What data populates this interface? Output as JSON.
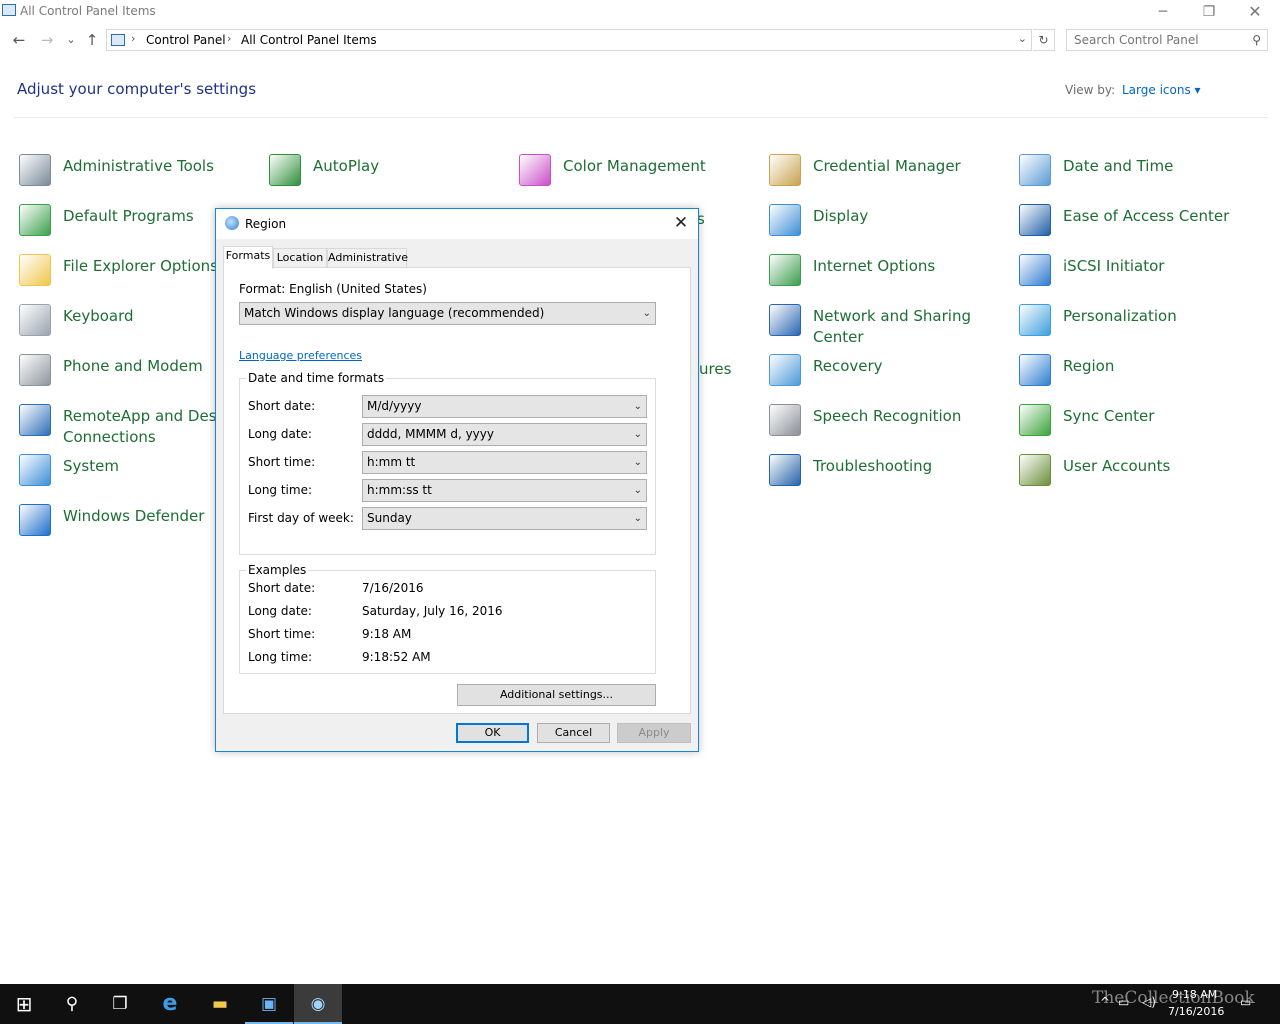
{
  "window": {
    "title": "All Control Panel Items",
    "controls": {
      "minimize": "─",
      "restore": "❐",
      "close": "✕"
    }
  },
  "nav": {
    "back": "←",
    "forward": "→",
    "recent": "⌄",
    "up": "↑"
  },
  "address": {
    "crumbs": [
      "Control Panel",
      "All Control Panel Items"
    ],
    "separator": "›",
    "dropdown": "⌄",
    "refresh": "↻"
  },
  "search": {
    "placeholder": "Search Control Panel",
    "icon": "⚲"
  },
  "header": {
    "heading": "Adjust your computer's settings",
    "view_by_label": "View by:",
    "view_by_value": "Large icons ▾"
  },
  "items": [
    {
      "label": "Administrative Tools",
      "icon": "admin-tools-icon",
      "color": "#7a8a99"
    },
    {
      "label": "AutoPlay",
      "icon": "autoplay-icon",
      "color": "#2f8f3a"
    },
    {
      "label": "Color Management",
      "icon": "color-management-icon",
      "color": "#c94fc9"
    },
    {
      "label": "Credential Manager",
      "icon": "credential-manager-icon",
      "color": "#c9a34f"
    },
    {
      "label": "Date and Time",
      "icon": "date-time-icon",
      "color": "#5b9bd5"
    },
    {
      "label": "Default Programs",
      "icon": "default-programs-icon",
      "color": "#3aa04a"
    },
    {
      "label": "Display",
      "icon": "display-icon",
      "color": "#3c8fd6"
    },
    {
      "label": "Ease of Access Center",
      "icon": "ease-of-access-icon",
      "color": "#1f5fa8"
    },
    {
      "label": "File Explorer Options",
      "icon": "file-explorer-icon",
      "color": "#f0c64a"
    },
    {
      "label": "Internet Options",
      "icon": "internet-options-icon",
      "color": "#3b9d4d"
    },
    {
      "label": "iSCSI Initiator",
      "icon": "iscsi-icon",
      "color": "#2e7bcf"
    },
    {
      "label": "Keyboard",
      "icon": "keyboard-icon",
      "color": "#9aa3ad"
    },
    {
      "label": "Network and Sharing Center",
      "icon": "network-sharing-icon",
      "color": "#2a66b0"
    },
    {
      "label": "Personalization",
      "icon": "personalization-icon",
      "color": "#3aa0dc"
    },
    {
      "label": "Phone and Modem",
      "icon": "phone-modem-icon",
      "color": "#8c949c"
    },
    {
      "label": "Recovery",
      "icon": "recovery-icon",
      "color": "#4a9ad8"
    },
    {
      "label": "Region",
      "icon": "region-icon",
      "color": "#2f7fd0"
    },
    {
      "label": "RemoteApp and Desktop Connections",
      "icon": "remoteapp-icon",
      "color": "#2c6fb8"
    },
    {
      "label": "Speech Recognition",
      "icon": "speech-recognition-icon",
      "color": "#8a8f96"
    },
    {
      "label": "Sync Center",
      "icon": "sync-center-icon",
      "color": "#3aa33a"
    },
    {
      "label": "System",
      "icon": "system-icon",
      "color": "#3b8fd8"
    },
    {
      "label": "Troubleshooting",
      "icon": "troubleshooting-icon",
      "color": "#2563a8"
    },
    {
      "label": "User Accounts",
      "icon": "user-accounts-icon",
      "color": "#6a8f3a"
    },
    {
      "label": "Windows Defender",
      "icon": "windows-defender-icon",
      "color": "#1d6fc9"
    }
  ],
  "hidden_fragments": {
    "item_s": "s",
    "item_ures": "ures"
  },
  "dialog": {
    "title": "Region",
    "close": "✕",
    "tabs": [
      "Formats",
      "Location",
      "Administrative"
    ],
    "format_label": "Format: English (United States)",
    "format_value": "Match Windows display language (recommended)",
    "language_link": "Language preferences",
    "datetime_group": "Date and time formats",
    "fields": [
      {
        "label": "Short date:",
        "value": "M/d/yyyy"
      },
      {
        "label": "Long date:",
        "value": "dddd, MMMM d, yyyy"
      },
      {
        "label": "Short time:",
        "value": "h:mm tt"
      },
      {
        "label": "Long time:",
        "value": "h:mm:ss tt"
      },
      {
        "label": "First day of week:",
        "value": "Sunday"
      }
    ],
    "examples_group": "Examples",
    "examples": [
      {
        "label": "Short date:",
        "value": "7/16/2016"
      },
      {
        "label": "Long date:",
        "value": "Saturday, July 16, 2016"
      },
      {
        "label": "Short time:",
        "value": "9:18 AM"
      },
      {
        "label": "Long time:",
        "value": "9:18:52 AM"
      }
    ],
    "additional_button": "Additional settings...",
    "ok": "OK",
    "cancel": "Cancel",
    "apply": "Apply",
    "combo_arrow": "⌄"
  },
  "taskbar": {
    "start": "⊞",
    "search": "⚲",
    "task_view": "❐",
    "ie": "e",
    "explorer": "▬",
    "control_panel": "▣",
    "region": "◉",
    "tray_up": "^",
    "tray_network": "▭",
    "tray_volume": "◁)",
    "time": "9:18 AM",
    "date": "7/16/2016",
    "notification": "▭",
    "watermark": "TheCollectionBook"
  }
}
